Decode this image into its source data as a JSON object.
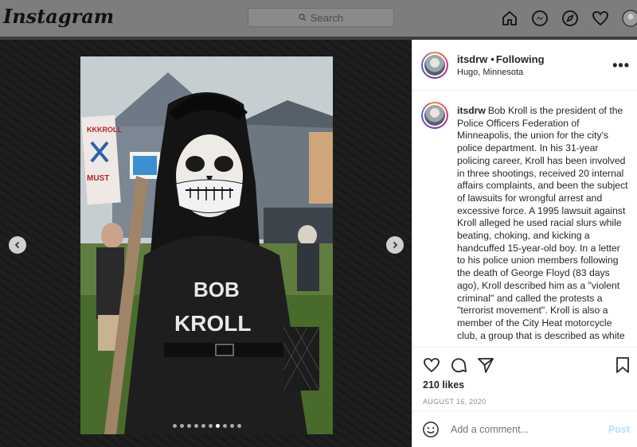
{
  "header": {
    "logo": "Instagram",
    "search_placeholder": "Search",
    "nav_icons": [
      "home-icon",
      "messenger-icon",
      "explore-icon",
      "heart-icon",
      "profile-icon"
    ]
  },
  "carousel": {
    "slide_count": 10,
    "active_index": 6,
    "prev_icon": "chevron-left-icon",
    "next_icon": "chevron-right-icon"
  },
  "post": {
    "username": "itsdrw",
    "bullet": "•",
    "follow_status": "Following",
    "location": "Hugo, Minnesota",
    "more_icon": "more-options-icon",
    "caption_user": "itsdrw",
    "caption": "Bob Kroll is the president of the Police Officers Federation of Minneapolis, the union for the city's police department. In his 31-year policing career, Kroll has been involved in three shootings, received 20 internal affairs complaints, and been the subject of lawsuits for wrongful arrest and excessive force. A 1995 lawsuit against Kroll alleged he used racial slurs while beating, choking, and kicking a handcuffed 15-year-old boy. In a letter to his police union members following the death of George Floyd (83 days ago), Kroll described him as a \"violent criminal\" and called the protests a \"terrorist movement\". Kroll is also a member of the City Heat motorcycle club, a group that is described as white",
    "likes": "210 likes",
    "date": "AUGUST 16, 2020",
    "comment_placeholder": "Add a comment...",
    "post_label": "Post",
    "action_icons": [
      "heart-icon",
      "comment-icon",
      "share-icon",
      "bookmark-icon"
    ]
  },
  "colors": {
    "accent": "#0095f6",
    "post_disabled": "#b2dffc",
    "text": "#262626",
    "muted": "#8e8e8e"
  }
}
